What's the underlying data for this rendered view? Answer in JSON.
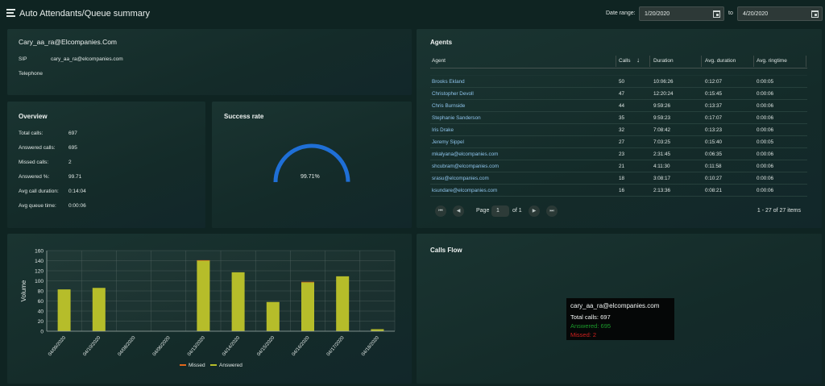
{
  "header": {
    "title": "Auto Attendants/Queue summary",
    "date_range_label": "Date range:",
    "from_date": "1/20/2020",
    "to_label": "to",
    "to_date": "4/20/2020"
  },
  "identity": {
    "title": "Cary_aa_ra@Elcompanies.Com",
    "sip_label": "SIP",
    "sip_value": "cary_aa_ra@elcompanies.com",
    "telephone_label": "Telephone"
  },
  "overview": {
    "title": "Overview",
    "rows": [
      {
        "label": "Total calls:",
        "value": "697"
      },
      {
        "label": "Answered calls:",
        "value": "695"
      },
      {
        "label": "Missed calls:",
        "value": "2"
      },
      {
        "label": "Answered %:",
        "value": "99.71"
      },
      {
        "label": "Avg call duration:",
        "value": "0:14:04"
      },
      {
        "label": "Avg queue time:",
        "value": "0:00:06"
      }
    ]
  },
  "success": {
    "title": "Success rate",
    "value_label": "99.71%",
    "fraction": 0.9971,
    "color": "#1f6fd6"
  },
  "agents": {
    "title": "Agents",
    "columns": [
      "Agent",
      "Calls",
      "Duration",
      "Avg. duration",
      "Avg. ringtime"
    ],
    "rows": [
      {
        "agent": "Brooks Ekland",
        "calls": "50",
        "duration": "10:06:26",
        "avg": "0:12:07",
        "ring": "0:00:05"
      },
      {
        "agent": "Christopher Devoll",
        "calls": "47",
        "duration": "12:20:24",
        "avg": "0:15:45",
        "ring": "0:00:06"
      },
      {
        "agent": "Chris Burnside",
        "calls": "44",
        "duration": "9:59:26",
        "avg": "0:13:37",
        "ring": "0:00:06"
      },
      {
        "agent": "Stephanie Sanderson",
        "calls": "35",
        "duration": "9:59:23",
        "avg": "0:17:07",
        "ring": "0:00:06"
      },
      {
        "agent": "Iris Drake",
        "calls": "32",
        "duration": "7:08:42",
        "avg": "0:13:23",
        "ring": "0:00:06"
      },
      {
        "agent": "Jeremy Sippel",
        "calls": "27",
        "duration": "7:03:25",
        "avg": "0:15:40",
        "ring": "0:00:05"
      },
      {
        "agent": "mkalyana@elcompanies.com",
        "calls": "23",
        "duration": "2:31:45",
        "avg": "0:06:35",
        "ring": "0:00:06"
      },
      {
        "agent": "shcubram@elcompanies.com",
        "calls": "21",
        "duration": "4:11:30",
        "avg": "0:11:58",
        "ring": "0:00:06"
      },
      {
        "agent": "srasu@elcompanies.com",
        "calls": "18",
        "duration": "3:08:17",
        "avg": "0:10:27",
        "ring": "0:00:06"
      },
      {
        "agent": "ksundare@elcompanies.com",
        "calls": "16",
        "duration": "2:13:36",
        "avg": "0:08:21",
        "ring": "0:00:06"
      }
    ],
    "pager": {
      "page_label": "Page",
      "page": "1",
      "of_label": "of 1",
      "items_label": "1 - 27 of 27 items"
    }
  },
  "calls_flow": {
    "title": "Calls Flow",
    "tooltip_title": "cary_aa_ra@elcompanies.com",
    "tooltip_total": "Total calls: 697",
    "tooltip_answered": "Answered: 695",
    "tooltip_missed": "Missed: 2",
    "answered_color": "#1c9a2b",
    "missed_color": "#d0201e"
  },
  "chart_data": {
    "type": "bar",
    "categories": [
      "04/09/2020",
      "04/10/2020",
      "04/08/2020",
      "04/06/2020",
      "04/13/2020",
      "04/14/2020",
      "04/15/2020",
      "04/16/2020",
      "04/17/2020",
      "04/18/2020"
    ],
    "series": [
      {
        "name": "Missed",
        "color": "#e0661a",
        "values": [
          0,
          0,
          0,
          0,
          1,
          0,
          0,
          1,
          0,
          0
        ]
      },
      {
        "name": "Answered",
        "color": "#b6bd2a",
        "values": [
          83,
          86,
          0,
          0,
          140,
          117,
          58,
          97,
          109,
          4
        ]
      }
    ],
    "ylabel": "Volume",
    "ylim": [
      0,
      160
    ],
    "yticks": [
      0,
      20,
      40,
      60,
      80,
      100,
      120,
      140,
      160
    ],
    "grid": true,
    "legend": "bottom"
  }
}
